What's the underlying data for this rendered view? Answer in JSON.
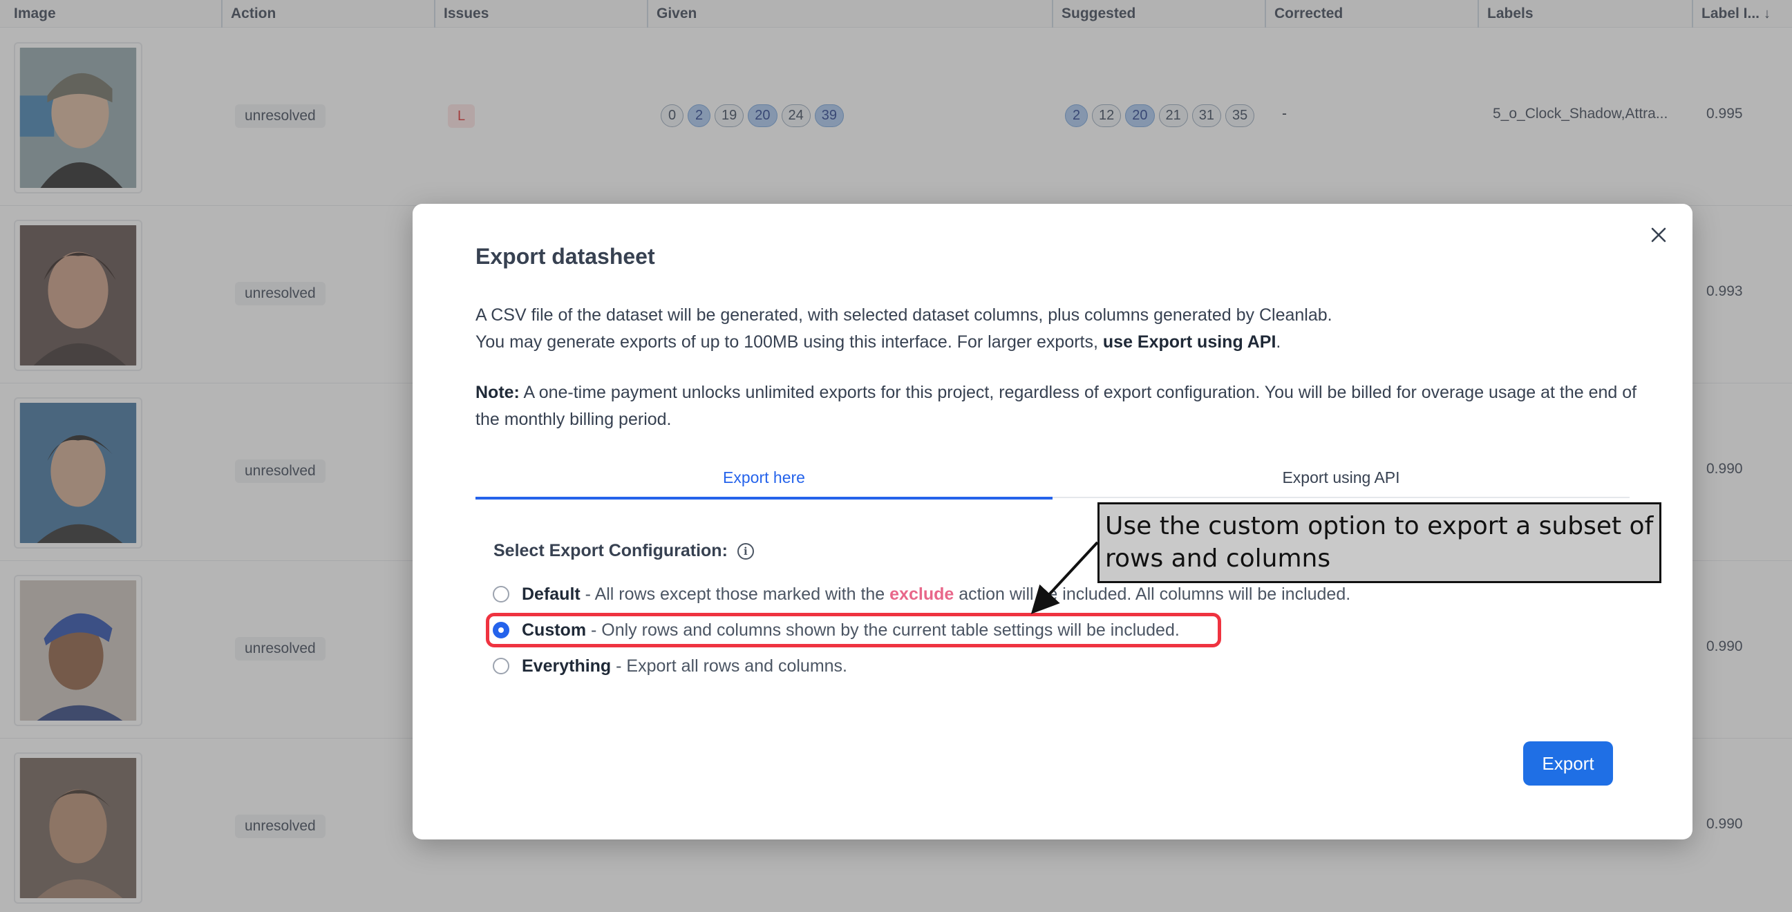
{
  "table": {
    "columns": [
      {
        "label": "Image"
      },
      {
        "label": "Action"
      },
      {
        "label": "Issues"
      },
      {
        "label": "Given"
      },
      {
        "label": "Suggested"
      },
      {
        "label": "Corrected"
      },
      {
        "label": "Labels"
      },
      {
        "label": "Label I...",
        "sort_icon": "↓"
      }
    ],
    "rows": [
      {
        "action": "unresolved",
        "issue": "L",
        "given": [
          "0",
          "2",
          "19",
          "20",
          "24",
          "39"
        ],
        "given_highlight": [
          false,
          true,
          false,
          true,
          false,
          true
        ],
        "suggested": [
          "2",
          "12",
          "20",
          "21",
          "31",
          "35"
        ],
        "suggested_highlight": [
          true,
          false,
          true,
          false,
          false,
          false
        ],
        "corrected": "-",
        "labels": "5_o_Clock_Shadow,Attra...",
        "score": "0.995"
      },
      {
        "action": "unresolved",
        "score": "0.993"
      },
      {
        "action": "unresolved",
        "score": "0.990"
      },
      {
        "action": "unresolved",
        "score": "0.990"
      },
      {
        "action": "unresolved",
        "score": "0.990"
      }
    ]
  },
  "modal": {
    "title": "Export datasheet",
    "close_icon": "close-icon",
    "desc_line1": "A CSV file of the dataset will be generated, with selected dataset columns, plus columns generated by Cleanlab.",
    "desc_line2_prefix": "You may generate exports of up to 100MB using this interface. For larger exports, ",
    "desc_line2_bold": "use Export using API",
    "desc_line2_suffix": ".",
    "note_label": "Note:",
    "note_text": " A one-time payment unlocks unlimited exports for this project, regardless of export configuration. You will be billed for overage usage at the end of the monthly billing period.",
    "tabs": [
      {
        "label": "Export here",
        "active": true
      },
      {
        "label": "Export using API",
        "active": false
      }
    ],
    "config_label": "Select Export Configuration:",
    "options": [
      {
        "name": "Default",
        "text_before": " - All rows except those marked with the ",
        "highlight": "exclude",
        "text_after": " action will be included. All columns will be included.",
        "selected": false
      },
      {
        "name": "Custom",
        "text_before": " - Only rows and columns shown by the current table settings will be included.",
        "selected": true
      },
      {
        "name": "Everything",
        "text_before": " - Export all rows and columns.",
        "selected": false
      }
    ],
    "export_label": "Export"
  },
  "annotation": {
    "text": "Use the custom option to export a subset of rows and columns"
  },
  "colors": {
    "accent": "#2563eb",
    "button": "#1f6fe5",
    "highlight_border": "#ef3340",
    "exclude_text": "#e8678a",
    "callout_bg": "#c9c9c9"
  }
}
